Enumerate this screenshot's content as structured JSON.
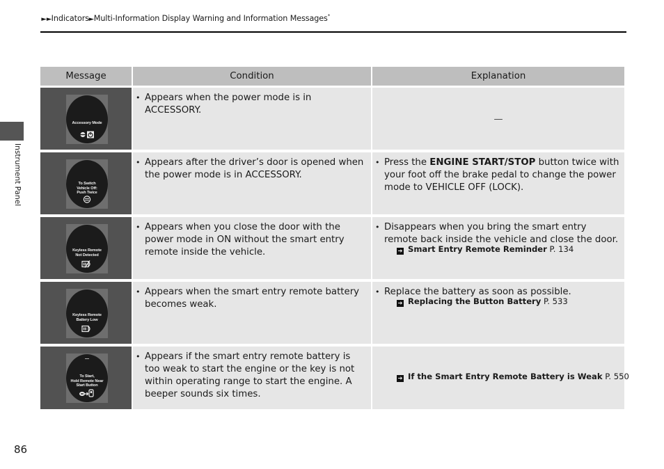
{
  "breadcrumb": {
    "sep": "►►",
    "section": "Indicators",
    "sep2": "►",
    "page": "Multi-Information Display Warning and Information Messages",
    "asterisk": "*"
  },
  "side_tab": {
    "label": "Instrument Panel"
  },
  "table": {
    "headers": {
      "message": "Message",
      "condition": "Condition",
      "explanation": "Explanation"
    },
    "rows": [
      {
        "screen_lines": [
          "Accessory Mode"
        ],
        "screen_icon": "accessory-power-icon",
        "condition": "Appears when the power mode is in ACCESSORY.",
        "explanation_dash": "—"
      },
      {
        "screen_lines": [
          "To Switch",
          "Vehicle Off:",
          "Push Twice"
        ],
        "screen_icon": "engine-start-button-icon",
        "condition": "Appears after the driver’s door is opened when the power mode is in ACCESSORY.",
        "explanation_pre": "Press the ",
        "explanation_bold": "ENGINE START/STOP",
        "explanation_post": " button twice with your foot off the brake pedal to change the power mode to VEHICLE OFF (LOCK)."
      },
      {
        "screen_lines": [
          "Keyless Remote",
          "Not Detected"
        ],
        "screen_icon": "key-not-detected-icon",
        "condition": "Appears when you close the door with the power mode in ON without the smart entry remote inside the vehicle.",
        "explanation": "Disappears when you bring the smart entry remote back inside the vehicle and close the door.",
        "ref_title": "Smart Entry Remote Reminder",
        "ref_page": "P. 134"
      },
      {
        "screen_lines": [
          "Keyless Remote",
          "Battery Low"
        ],
        "screen_icon": "key-battery-low-icon",
        "condition": "Appears when the smart entry remote battery becomes weak.",
        "explanation": "Replace the battery as soon as possible.",
        "ref_title": "Replacing the Button Battery",
        "ref_page": "P. 533"
      },
      {
        "screen_lines": [
          "To Start,",
          "Hold Remote Near",
          "Start Button"
        ],
        "screen_icon": "hold-remote-near-button-icon",
        "condition": "Appears if the smart entry remote battery is too weak to start the engine or the key is not within operating range to start the engine. A beeper sounds six times.",
        "ref_title": "If the Smart Entry Remote Battery is Weak",
        "ref_page": "P. 550"
      }
    ]
  },
  "page_number": "86"
}
